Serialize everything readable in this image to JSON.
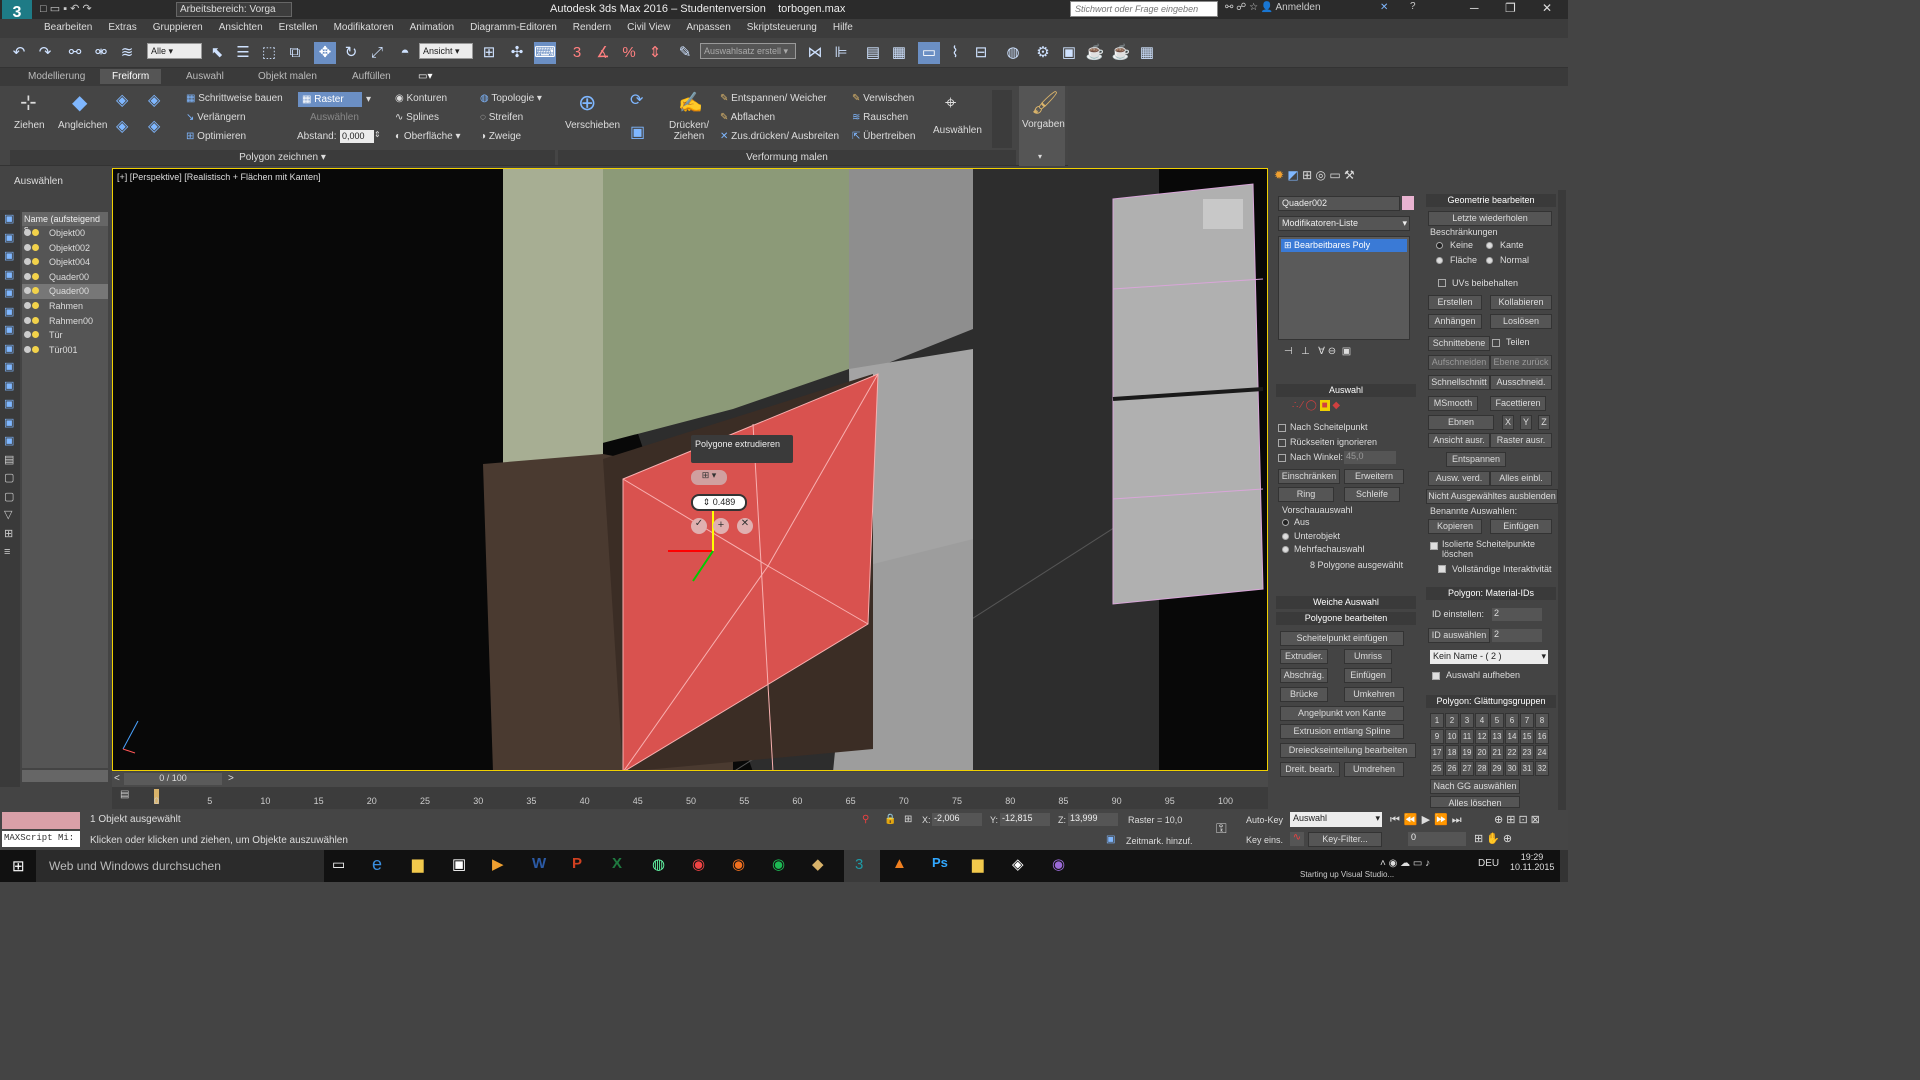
{
  "title": {
    "workspace": "Arbeitsbereich: Vorga",
    "app": "Autodesk 3ds Max 2016 – Studentenversion",
    "file": "torbogen.max",
    "search_placeholder": "Stichwort oder Frage eingeben",
    "login": "Anmelden"
  },
  "menu": [
    "Bearbeiten",
    "Extras",
    "Gruppieren",
    "Ansichten",
    "Erstellen",
    "Modifikatoren",
    "Animation",
    "Diagramm-Editoren",
    "Rendern",
    "Civil View",
    "Anpassen",
    "Skriptsteuerung",
    "Hilfe"
  ],
  "toolbar": {
    "filter": "Alle",
    "view": "Ansicht",
    "selection_set": "Auswahlsatz erstell"
  },
  "ribbon_tabs": [
    "Modellierung",
    "Freiform",
    "Auswahl",
    "Objekt malen",
    "Auffüllen"
  ],
  "ribbon": {
    "ziehen": "Ziehen",
    "angleichen": "Angleichen",
    "schrittweise": "Schrittweise bauen",
    "verlaengern": "Verlängern",
    "optimieren": "Optimieren",
    "raster": "Raster",
    "auswaehlen": "Auswählen",
    "abstand_label": "Abstand:",
    "abstand_value": "0,000",
    "konturen": "Konturen",
    "splines": "Splines",
    "oberflaeche": "Oberfläche",
    "topologie": "Topologie",
    "streifen": "Streifen",
    "zweige": "Zweige",
    "polygon_zeichnen": "Polygon zeichnen",
    "verschieben": "Verschieben",
    "druecken": "Drücken/ Ziehen",
    "entspannen": "Entspannen/ Weicher",
    "abflachen": "Abflachen",
    "zusdruecken": "Zus.drücken/ Ausbreiten",
    "verwischen": "Verwischen",
    "rauschen": "Rauschen",
    "uebertreiben": "Übertreiben",
    "verformung": "Verformung malen",
    "auswaehlen2": "Auswählen",
    "vorgaben": "Vorgaben"
  },
  "left": {
    "label": "Auswählen",
    "scene_header": "Name (aufsteigend s",
    "objects": [
      "Objekt00",
      "Objekt002",
      "Objekt004",
      "Quader00",
      "Quader00",
      "Rahmen",
      "Rahmen00",
      "Tür",
      "Tür001"
    ]
  },
  "viewport": {
    "label": "[+] [Perspektive] [Realistisch + Flächen mit Kanten]",
    "tooltip": "Polygone extrudieren",
    "caddy_value": "0.489"
  },
  "cmd": {
    "object_name": "Quader002",
    "modlist": "Modifikatoren-Liste",
    "stack_item": "Bearbeitbares Poly",
    "auswahl_title": "Auswahl",
    "nach_scheitelpunkt": "Nach Scheitelpunkt",
    "rueckseiten": "Rückseiten ignorieren",
    "nach_winkel": "Nach Winkel:",
    "winkel": "45,0",
    "einschraenken": "Einschränken",
    "erweitern": "Erweitern",
    "ring": "Ring",
    "schleife": "Schleife",
    "vorschau": "Vorschauauswahl",
    "aus": "Aus",
    "unterobjekt": "Unterobjekt",
    "mehrfach": "Mehrfachauswahl",
    "count": "8 Polygone ausgewählt",
    "weiche": "Weiche Auswahl",
    "poly_edit": "Polygone bearbeiten",
    "scheitelpunkt": "Scheitelpunkt einfügen",
    "extrudier": "Extrudier.",
    "umriss": "Umriss",
    "abschraeg": "Abschräg.",
    "einfuegen": "Einfügen",
    "bruecke": "Brücke",
    "umkehren": "Umkehren",
    "angelpunkt": "Angelpunkt von Kante",
    "extrusion": "Extrusion entlang Spline",
    "dreieck": "Dreieckseinteilung bearbeiten",
    "dreit": "Dreit. bearb.",
    "umdrehen": "Umdrehen"
  },
  "right": {
    "geo_title": "Geometrie bearbeiten",
    "letzte": "Letzte wiederholen",
    "beschraenkungen": "Beschränkungen",
    "keine": "Keine",
    "kante": "Kante",
    "flaeche": "Fläche",
    "normal": "Normal",
    "uvs": "UVs beibehalten",
    "erstellen": "Erstellen",
    "kollabieren": "Kollabieren",
    "anhaengen": "Anhängen",
    "loslosen": "Loslösen",
    "schnittebene": "Schnittebene",
    "teilen": "Teilen",
    "aufschneiden": "Aufschneiden",
    "ebene_zurueck": "Ebene zurück",
    "schnellschnitt": "Schnellschnitt",
    "ausschneid": "Ausschneid.",
    "msmooth": "MSmooth",
    "facettieren": "Facettieren",
    "ebnen": "Ebnen",
    "x": "X",
    "y": "Y",
    "z": "Z",
    "ansicht_ausr": "Ansicht ausr.",
    "raster_ausr": "Raster ausr.",
    "entspannen": "Entspannen",
    "ausw_verd": "Ausw. verd.",
    "alles_einbl": "Alles einbl.",
    "nicht_ausgew": "Nicht Ausgewähltes ausblenden",
    "benannte": "Benannte Auswahlen:",
    "kopieren": "Kopieren",
    "einfuegen": "Einfügen",
    "isolierte": "Isolierte Scheitelpunkte löschen",
    "vollstaendige": "Vollständige Interaktivität",
    "matid_title": "Polygon: Material-IDs",
    "id_einstellen": "ID einstellen:",
    "id_einstellen_val": "2",
    "id_auswaehlen": "ID auswählen",
    "id_auswaehlen_val": "2",
    "kein_name": "Kein Name - ( 2 )",
    "auswahl_aufheben": "Auswahl aufheben",
    "glaettung_title": "Polygon: Glättungsgruppen",
    "groups": [
      "1",
      "2",
      "3",
      "4",
      "5",
      "6",
      "7",
      "8",
      "9",
      "10",
      "11",
      "12",
      "13",
      "14",
      "15",
      "16",
      "17",
      "18",
      "19",
      "20",
      "21",
      "22",
      "23",
      "24",
      "25",
      "26",
      "27",
      "28",
      "29",
      "30",
      "31",
      "32"
    ],
    "nach_gg": "Nach GG auswählen",
    "alles_loeschen": "Alles löschen"
  },
  "timeline": {
    "frame": "0 / 100",
    "ticks": [
      "0",
      "5",
      "10",
      "15",
      "20",
      "25",
      "30",
      "35",
      "40",
      "45",
      "50",
      "55",
      "60",
      "65",
      "70",
      "75",
      "80",
      "85",
      "90",
      "95",
      "100"
    ]
  },
  "status": {
    "maxscript": "MAXScript Mi:",
    "selected": "1 Objekt ausgewählt",
    "hint": "Klicken oder klicken und ziehen, um Objekte auszuwählen",
    "x_label": "X:",
    "x": "-2,006",
    "y_label": "Y:",
    "y": "-12,815",
    "z_label": "Z:",
    "z": "13,999",
    "raster": "Raster = 10,0",
    "zeitmark": "Zeitmark. hinzuf.",
    "autokey": "Auto-Key",
    "auswahl": "Auswahl",
    "keyeins": "Key eins.",
    "keyfilter": "Key-Filter...",
    "frame_field": "0"
  },
  "taskbar": {
    "search": "Web und Windows durchsuchen",
    "lang": "DEU",
    "time": "19:29",
    "date": "10.11.2015",
    "notice": "Starting up Visual Studio..."
  }
}
